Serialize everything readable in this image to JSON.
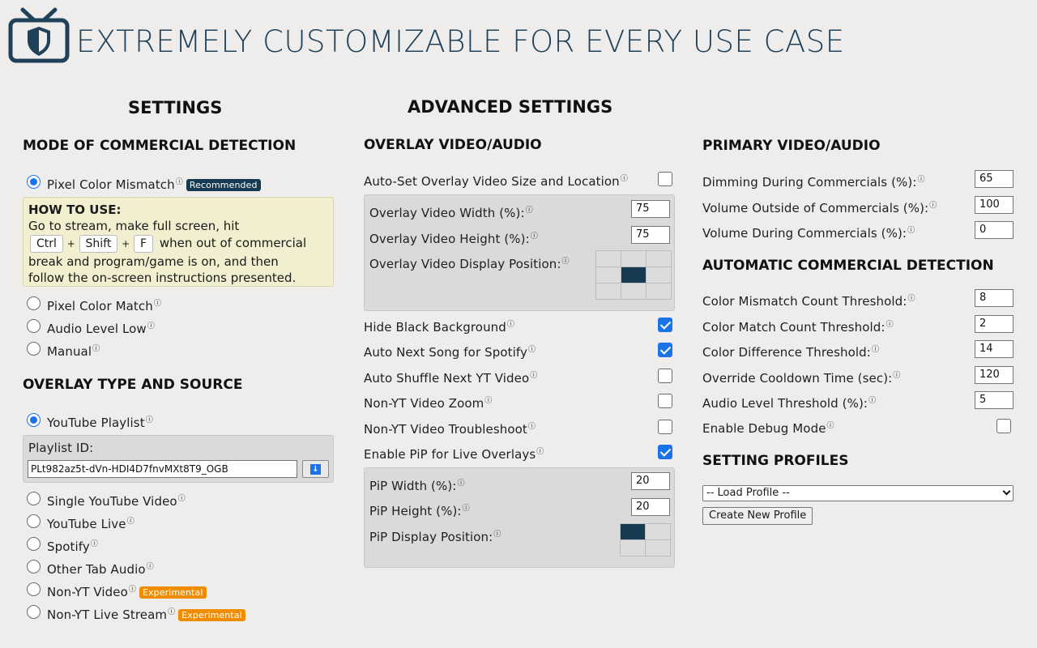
{
  "header": {
    "title": "EXTREMELY CUSTOMIZABLE FOR EVERY USE CASE",
    "logo_icon": "tv-shield-icon",
    "brand_color": "#1f4159"
  },
  "settings": {
    "title": "SETTINGS",
    "mode_heading": "MODE OF COMMERCIAL DETECTION",
    "modes": [
      {
        "label": "Pixel Color Mismatch",
        "badge": "Recommended",
        "selected": true
      },
      {
        "label": "Pixel Color Match",
        "selected": false
      },
      {
        "label": "Audio Level Low",
        "selected": false
      },
      {
        "label": "Manual",
        "selected": false
      }
    ],
    "howto": {
      "title": "HOW TO USE:",
      "line1": "Go to stream, make full screen, hit",
      "keys": [
        "Ctrl",
        "Shift",
        "F"
      ],
      "plus": "+",
      "line2": "when out of commercial",
      "line3": "break and program/game is on, and then",
      "line4": "follow the on-screen instructions presented."
    },
    "overlay_heading": "OVERLAY TYPE AND SOURCE",
    "overlay_types": [
      {
        "label": "YouTube Playlist",
        "selected": true
      },
      {
        "label": "Single YouTube Video",
        "selected": false
      },
      {
        "label": "YouTube Live",
        "selected": false
      },
      {
        "label": "Spotify",
        "selected": false
      },
      {
        "label": "Other Tab Audio",
        "selected": false
      },
      {
        "label": "Non-YT Video",
        "badge": "Experimental",
        "selected": false
      },
      {
        "label": "Non-YT Live Stream",
        "badge": "Experimental",
        "selected": false
      }
    ],
    "playlist": {
      "label": "Playlist ID:",
      "value": "PLt982az5t-dVn-HDI4D7fnvMXt8T9_OGB",
      "button_icon": "download-arrow-icon",
      "button_glyph": "↓"
    }
  },
  "advanced": {
    "title": "ADVANCED SETTINGS",
    "overlay_heading": "OVERLAY VIDEO/AUDIO",
    "auto_set": {
      "label": "Auto-Set Overlay Video Size and Location",
      "checked": false
    },
    "width": {
      "label": "Overlay Video Width (%):",
      "value": "75"
    },
    "height": {
      "label": "Overlay Video Height (%):",
      "value": "75"
    },
    "position": {
      "label": "Overlay Video Display Position:",
      "selected_cell": 4
    },
    "toggles": [
      {
        "label": "Hide Black Background",
        "checked": true
      },
      {
        "label": "Auto Next Song for Spotify",
        "checked": true
      },
      {
        "label": "Auto Shuffle Next YT Video",
        "checked": false
      },
      {
        "label": "Non-YT Video Zoom",
        "checked": false
      },
      {
        "label": "Non-YT Video Troubleshoot",
        "checked": false
      },
      {
        "label": "Enable PiP for Live Overlays",
        "checked": true
      }
    ],
    "pip_width": {
      "label": "PiP Width (%):",
      "value": "20"
    },
    "pip_height": {
      "label": "PiP Height (%):",
      "value": "20"
    },
    "pip_position": {
      "label": "PiP Display Position:",
      "selected_cell": 0
    }
  },
  "primary": {
    "heading": "PRIMARY VIDEO/AUDIO",
    "fields": [
      {
        "label": "Dimming During Commercials (%):",
        "value": "65"
      },
      {
        "label": "Volume Outside of Commercials (%):",
        "value": "100"
      },
      {
        "label": "Volume During Commercials (%):",
        "value": "0"
      }
    ],
    "auto_heading": "AUTOMATIC COMMERCIAL DETECTION",
    "auto_fields": [
      {
        "label": "Color Mismatch Count Threshold:",
        "value": "8"
      },
      {
        "label": "Color Match Count Threshold:",
        "value": "2"
      },
      {
        "label": "Color Difference Threshold:",
        "value": "14"
      },
      {
        "label": "Override Cooldown Time (sec):",
        "value": "120"
      },
      {
        "label": "Audio Level Threshold (%):",
        "value": "5"
      }
    ],
    "debug": {
      "label": "Enable Debug Mode",
      "checked": false
    },
    "profiles_heading": "SETTING PROFILES",
    "profile_select": "-- Load Profile --",
    "create_button": "Create New Profile"
  },
  "info_glyph": "ⓘ"
}
